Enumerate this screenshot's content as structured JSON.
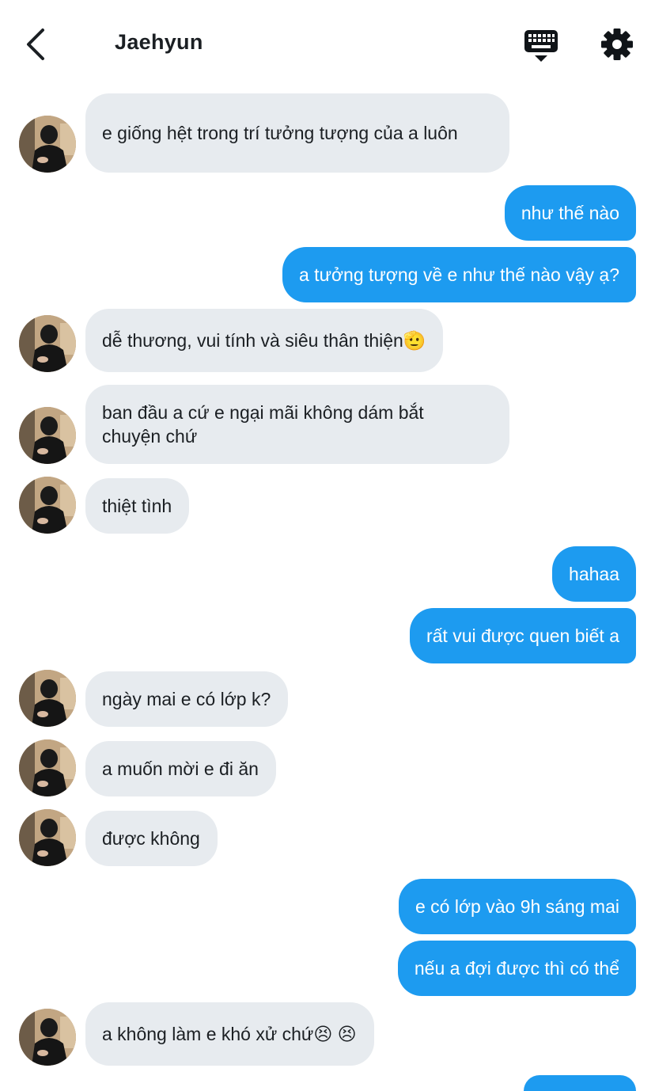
{
  "header": {
    "title": "Jaehyun"
  },
  "colors": {
    "outgoing": "#1d9bf0",
    "incoming": "#e7ebef",
    "text": "#1b1f23"
  },
  "messages": [
    {
      "dir": "in",
      "text": "e giống hệt trong trí tưởng tượng của a luôn"
    },
    {
      "dir": "out",
      "text": "như thế nào"
    },
    {
      "dir": "out",
      "text": "a tưởng tượng về e như thế nào vậy ạ?"
    },
    {
      "dir": "in",
      "text": "dễ thương, vui tính và siêu thân thiện🫡"
    },
    {
      "dir": "in",
      "text": "ban đầu a cứ e ngại mãi không dám bắt chuyện chứ"
    },
    {
      "dir": "in",
      "text": "thiệt tình"
    },
    {
      "dir": "out",
      "text": "hahaa"
    },
    {
      "dir": "out",
      "text": "rất vui được quen biết a"
    },
    {
      "dir": "in",
      "text": "ngày mai e có lớp k?"
    },
    {
      "dir": "in",
      "text": "a muốn mời e đi ăn"
    },
    {
      "dir": "in",
      "text": "được không"
    },
    {
      "dir": "out",
      "text": "e có lớp vào 9h sáng mai"
    },
    {
      "dir": "out",
      "text": "nếu a đợi được thì có thể"
    },
    {
      "dir": "in",
      "text": "a không làm e khó xử chứ😣 😣"
    }
  ]
}
